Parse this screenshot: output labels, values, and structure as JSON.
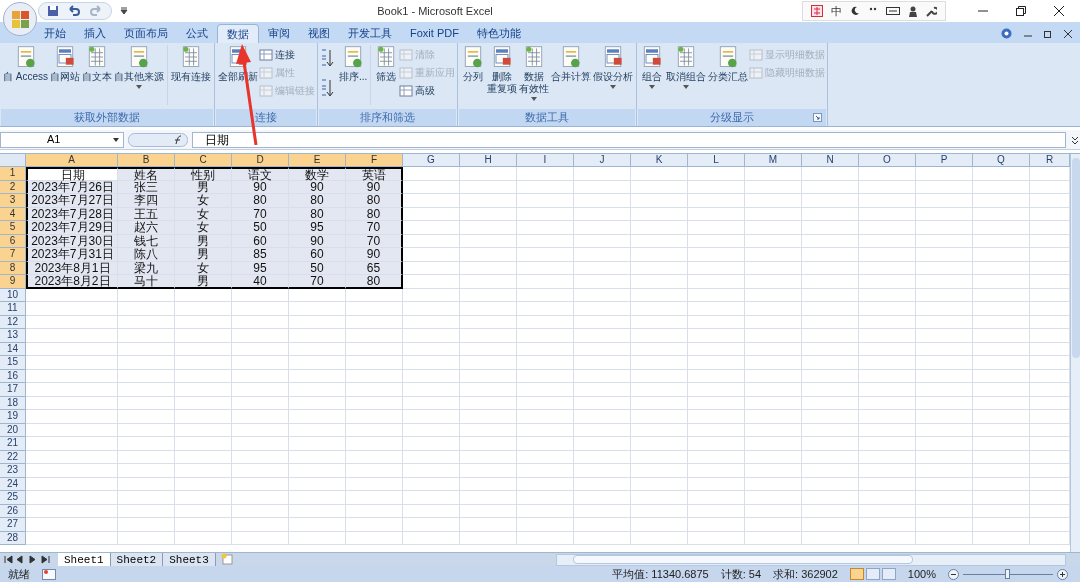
{
  "window": {
    "title": "Book1 - Microsoft Excel",
    "ime": "中"
  },
  "tabs": [
    {
      "label": "开始",
      "selected": false
    },
    {
      "label": "插入",
      "selected": false
    },
    {
      "label": "页面布局",
      "selected": false
    },
    {
      "label": "公式",
      "selected": false
    },
    {
      "label": "数据",
      "selected": true
    },
    {
      "label": "审阅",
      "selected": false
    },
    {
      "label": "视图",
      "selected": false
    },
    {
      "label": "开发工具",
      "selected": false
    },
    {
      "label": "Foxit PDF",
      "selected": false
    },
    {
      "label": "特色功能",
      "selected": false
    }
  ],
  "ribbon": {
    "groups": [
      {
        "label": "获取外部数据",
        "launcher": false,
        "buttons": [
          {
            "kind": "large",
            "lines": [
              "自 Access"
            ],
            "disabled": false,
            "dropdown": false
          },
          {
            "kind": "large",
            "lines": [
              "自网站"
            ],
            "disabled": false,
            "dropdown": false
          },
          {
            "kind": "large",
            "lines": [
              "自文本"
            ],
            "disabled": false,
            "dropdown": false
          },
          {
            "kind": "large",
            "lines": [
              "自其他来源"
            ],
            "disabled": false,
            "dropdown": true
          },
          {
            "kind": "separator"
          },
          {
            "kind": "large",
            "lines": [
              "现有连接"
            ],
            "disabled": false,
            "dropdown": false
          }
        ]
      },
      {
        "label": "连接",
        "launcher": false,
        "buttons": [
          {
            "kind": "large",
            "lines": [
              "全部刷新"
            ],
            "disabled": false,
            "dropdown": false
          },
          {
            "kind": "stack",
            "items": [
              {
                "label": "连接",
                "disabled": false
              },
              {
                "label": "属性",
                "disabled": true
              },
              {
                "label": "编辑链接",
                "disabled": true
              }
            ]
          }
        ]
      },
      {
        "label": "排序和筛选",
        "launcher": false,
        "buttons": [
          {
            "kind": "sortpair"
          },
          {
            "kind": "large",
            "lines": [
              "排序..."
            ],
            "disabled": false,
            "dropdown": false
          },
          {
            "kind": "separator"
          },
          {
            "kind": "large",
            "lines": [
              "筛选"
            ],
            "disabled": false,
            "dropdown": false
          },
          {
            "kind": "stack",
            "items": [
              {
                "label": "清除",
                "disabled": true
              },
              {
                "label": "重新应用",
                "disabled": true
              },
              {
                "label": "高级",
                "disabled": false
              }
            ]
          }
        ]
      },
      {
        "label": "数据工具",
        "launcher": false,
        "buttons": [
          {
            "kind": "large",
            "lines": [
              "分列"
            ],
            "disabled": false,
            "dropdown": false
          },
          {
            "kind": "large",
            "lines": [
              "删除",
              "重复项"
            ],
            "disabled": false,
            "dropdown": false
          },
          {
            "kind": "large",
            "lines": [
              "数据",
              "有效性"
            ],
            "disabled": false,
            "dropdown": true
          },
          {
            "kind": "large",
            "lines": [
              "合并计算"
            ],
            "disabled": false,
            "dropdown": false
          },
          {
            "kind": "large",
            "lines": [
              "假设分析"
            ],
            "disabled": false,
            "dropdown": true
          }
        ]
      },
      {
        "label": "分级显示",
        "launcher": true,
        "buttons": [
          {
            "kind": "large",
            "lines": [
              "组合"
            ],
            "disabled": false,
            "dropdown": true
          },
          {
            "kind": "large",
            "lines": [
              "取消组合"
            ],
            "disabled": false,
            "dropdown": true
          },
          {
            "kind": "large",
            "lines": [
              "分类汇总"
            ],
            "disabled": false,
            "dropdown": false
          },
          {
            "kind": "stack",
            "items": [
              {
                "label": "显示明细数据",
                "disabled": true
              },
              {
                "label": "隐藏明细数据",
                "disabled": true
              }
            ]
          }
        ]
      }
    ]
  },
  "formula_bar": {
    "name_box": "A1",
    "value": "日期"
  },
  "sheet": {
    "columns": [
      {
        "label": "A",
        "selected": true,
        "active": true
      },
      {
        "label": "B",
        "selected": true,
        "active": false
      },
      {
        "label": "C",
        "selected": true,
        "active": false
      },
      {
        "label": "D",
        "selected": true,
        "active": false
      },
      {
        "label": "E",
        "selected": true,
        "active": false
      },
      {
        "label": "F",
        "selected": true,
        "active": false
      },
      {
        "label": "G",
        "selected": false,
        "active": false
      },
      {
        "label": "H",
        "selected": false,
        "active": false
      },
      {
        "label": "I",
        "selected": false,
        "active": false
      },
      {
        "label": "J",
        "selected": false,
        "active": false
      },
      {
        "label": "K",
        "selected": false,
        "active": false
      },
      {
        "label": "L",
        "selected": false,
        "active": false
      },
      {
        "label": "M",
        "selected": false,
        "active": false
      },
      {
        "label": "N",
        "selected": false,
        "active": false
      },
      {
        "label": "O",
        "selected": false,
        "active": false
      },
      {
        "label": "P",
        "selected": false,
        "active": false
      },
      {
        "label": "Q",
        "selected": false,
        "active": false
      },
      {
        "label": "R",
        "selected": false,
        "active": false
      }
    ],
    "rows": [
      {
        "label": "1",
        "selected": true,
        "active": true,
        "cells": [
          "日期",
          "姓名",
          "性别",
          "语文",
          "数学",
          "英语"
        ]
      },
      {
        "label": "2",
        "selected": true,
        "active": false,
        "cells": [
          "2023年7月26日",
          "张三",
          "男",
          "90",
          "90",
          "90"
        ]
      },
      {
        "label": "3",
        "selected": true,
        "active": false,
        "cells": [
          "2023年7月27日",
          "李四",
          "女",
          "80",
          "80",
          "80"
        ]
      },
      {
        "label": "4",
        "selected": true,
        "active": false,
        "cells": [
          "2023年7月28日",
          "王五",
          "女",
          "70",
          "80",
          "80"
        ]
      },
      {
        "label": "5",
        "selected": true,
        "active": false,
        "cells": [
          "2023年7月29日",
          "赵六",
          "女",
          "50",
          "95",
          "70"
        ]
      },
      {
        "label": "6",
        "selected": true,
        "active": false,
        "cells": [
          "2023年7月30日",
          "钱七",
          "男",
          "60",
          "90",
          "70"
        ]
      },
      {
        "label": "7",
        "selected": true,
        "active": false,
        "cells": [
          "2023年7月31日",
          "陈八",
          "男",
          "85",
          "60",
          "90"
        ]
      },
      {
        "label": "8",
        "selected": true,
        "active": false,
        "cells": [
          "2023年8月1日",
          "梁九",
          "女",
          "95",
          "50",
          "65"
        ]
      },
      {
        "label": "9",
        "selected": true,
        "active": false,
        "cells": [
          "2023年8月2日",
          "马十",
          "男",
          "40",
          "70",
          "80"
        ]
      },
      {
        "label": "10",
        "selected": false,
        "active": false
      },
      {
        "label": "11",
        "selected": false,
        "active": false
      },
      {
        "label": "12",
        "selected": false,
        "active": false
      },
      {
        "label": "13",
        "selected": false,
        "active": false
      },
      {
        "label": "14",
        "selected": false,
        "active": false
      },
      {
        "label": "15",
        "selected": false,
        "active": false
      },
      {
        "label": "16",
        "selected": false,
        "active": false
      },
      {
        "label": "17",
        "selected": false,
        "active": false
      },
      {
        "label": "18",
        "selected": false,
        "active": false
      },
      {
        "label": "19",
        "selected": false,
        "active": false
      },
      {
        "label": "20",
        "selected": false,
        "active": false
      },
      {
        "label": "21",
        "selected": false,
        "active": false
      },
      {
        "label": "22",
        "selected": false,
        "active": false
      },
      {
        "label": "23",
        "selected": false,
        "active": false
      },
      {
        "label": "24",
        "selected": false,
        "active": false
      },
      {
        "label": "25",
        "selected": false,
        "active": false
      },
      {
        "label": "26",
        "selected": false,
        "active": false
      },
      {
        "label": "27",
        "selected": false,
        "active": false
      },
      {
        "label": "28",
        "selected": false,
        "active": false
      }
    ]
  },
  "sheet_tabs": [
    {
      "label": "Sheet1",
      "selected": true
    },
    {
      "label": "Sheet2",
      "selected": false
    },
    {
      "label": "Sheet3",
      "selected": false
    }
  ],
  "status_bar": {
    "mode": "就绪",
    "average": "平均值: 11340.6875",
    "count": "计数: 54",
    "sum": "求和: 362902",
    "views": [
      {
        "selected": true
      },
      {
        "selected": false
      },
      {
        "selected": false
      }
    ],
    "zoom": "100%",
    "zoom_level": {
      "level": 0.5
    }
  },
  "annotation": {
    "kind": "arrow"
  }
}
